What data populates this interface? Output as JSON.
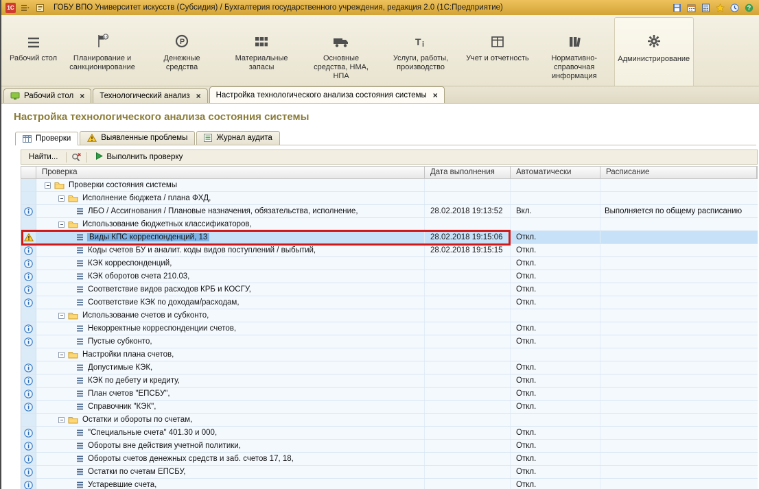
{
  "colors": {
    "annotation_red": "#d01818",
    "selection_blue": "#c7e2f8",
    "title_gold": "#8a7c39",
    "titlebar_gold": "#d2a336"
  },
  "titlebar": {
    "title": "ГОБУ ВПО Университет искусств (Субсидия) / Бухгалтерия государственного учреждения, редакция 2.0 (1С:Предприятие)",
    "right_icons": [
      "save",
      "calendar",
      "calculator",
      "favorites",
      "history",
      "help"
    ]
  },
  "ribbon": {
    "sections": [
      {
        "id": "desktop",
        "label": "Рабочий стол",
        "icon": "menu",
        "active": false
      },
      {
        "id": "planning",
        "label": "Планирование и санкционирование",
        "icon": "plan",
        "active": false
      },
      {
        "id": "money",
        "label": "Денежные средства",
        "icon": "money",
        "active": false
      },
      {
        "id": "materials",
        "label": "Материальные запасы",
        "icon": "mat",
        "active": false
      },
      {
        "id": "assets",
        "label": "Основные средства, НМА, НПА",
        "icon": "truck",
        "active": false
      },
      {
        "id": "services",
        "label": "Услуги, работы, производство",
        "icon": "serv",
        "active": false
      },
      {
        "id": "accounting",
        "label": "Учет и отчетность",
        "icon": "acct",
        "active": false
      },
      {
        "id": "reference",
        "label": "Нормативно-справочная информация",
        "icon": "ref",
        "active": false
      },
      {
        "id": "administration",
        "label": "Администрирование",
        "icon": "gear",
        "active": true
      }
    ]
  },
  "tabs": [
    {
      "id": "desktop",
      "label": "Рабочий стол",
      "icon": "desk",
      "active": false
    },
    {
      "id": "tech-analysis",
      "label": "Технологический анализ",
      "icon": "",
      "active": false
    },
    {
      "id": "tech-settings",
      "label": "Настройка технологического анализа состояния системы",
      "icon": "",
      "active": true
    }
  ],
  "page": {
    "title": "Настройка технологического анализа состояния системы",
    "subtabs": [
      {
        "id": "checks",
        "label": "Проверки",
        "icon": "tbl",
        "active": true
      },
      {
        "id": "problems",
        "label": "Выявленные проблемы",
        "icon": "warn",
        "active": false
      },
      {
        "id": "audit",
        "label": "Журнал аудита",
        "icon": "jour",
        "active": false
      }
    ],
    "toolbar": {
      "find_label": "Найти...",
      "run_label": "Выполнить проверку"
    },
    "table": {
      "columns": [
        "Проверка",
        "Дата выполнения",
        "Автоматически",
        "Расписание"
      ],
      "rows": [
        {
          "type": "folder",
          "level": 0,
          "label": "Проверки состояния системы",
          "date": "",
          "auto": "",
          "schedule": ""
        },
        {
          "type": "folder",
          "level": 1,
          "label": "Исполнение бюджета / плана ФХД,",
          "date": "",
          "auto": "",
          "schedule": ""
        },
        {
          "type": "leaf",
          "level": 2,
          "label": "ЛБО / Ассигнования / Плановые назначения, обязательства, исполнение,",
          "date": "28.02.2018 19:13:52",
          "auto": "Вкл.",
          "schedule": "Выполняется по общему расписанию"
        },
        {
          "type": "folder",
          "level": 1,
          "label": "Использование бюджетных классификаторов,",
          "date": "",
          "auto": "",
          "schedule": ""
        },
        {
          "type": "leaf",
          "level": 2,
          "label": "Виды КПС корреспонденций, 13",
          "date": "28.02.2018 19:15:06",
          "auto": "Откл.",
          "schedule": "",
          "selected": true,
          "warning": true
        },
        {
          "type": "leaf",
          "level": 2,
          "label": "Коды счетов БУ и аналит. коды видов поступлений / выбытий,",
          "date": "28.02.2018 19:15:15",
          "auto": "Откл.",
          "schedule": ""
        },
        {
          "type": "leaf",
          "level": 2,
          "label": "КЭК корреспонденций,",
          "date": "",
          "auto": "Откл.",
          "schedule": ""
        },
        {
          "type": "leaf",
          "level": 2,
          "label": "КЭК оборотов счета 210.03,",
          "date": "",
          "auto": "Откл.",
          "schedule": ""
        },
        {
          "type": "leaf",
          "level": 2,
          "label": "Соответствие видов расходов КРБ и КОСГУ,",
          "date": "",
          "auto": "Откл.",
          "schedule": ""
        },
        {
          "type": "leaf",
          "level": 2,
          "label": "Соответствие КЭК по доходам/расходам,",
          "date": "",
          "auto": "Откл.",
          "schedule": ""
        },
        {
          "type": "folder",
          "level": 1,
          "label": "Использование счетов и субконто,",
          "date": "",
          "auto": "",
          "schedule": ""
        },
        {
          "type": "leaf",
          "level": 2,
          "label": "Некорректные корреспонденции счетов,",
          "date": "",
          "auto": "Откл.",
          "schedule": ""
        },
        {
          "type": "leaf",
          "level": 2,
          "label": "Пустые субконто,",
          "date": "",
          "auto": "Откл.",
          "schedule": ""
        },
        {
          "type": "folder",
          "level": 1,
          "label": "Настройки плана счетов,",
          "date": "",
          "auto": "",
          "schedule": ""
        },
        {
          "type": "leaf",
          "level": 2,
          "label": "Допустимые КЭК,",
          "date": "",
          "auto": "Откл.",
          "schedule": ""
        },
        {
          "type": "leaf",
          "level": 2,
          "label": "КЭК по дебету и кредиту,",
          "date": "",
          "auto": "Откл.",
          "schedule": ""
        },
        {
          "type": "leaf",
          "level": 2,
          "label": "План счетов \"ЕПСБУ\",",
          "date": "",
          "auto": "Откл.",
          "schedule": ""
        },
        {
          "type": "leaf",
          "level": 2,
          "label": "Справочник \"КЭК\",",
          "date": "",
          "auto": "Откл.",
          "schedule": ""
        },
        {
          "type": "folder",
          "level": 1,
          "label": "Остатки и обороты по счетам,",
          "date": "",
          "auto": "",
          "schedule": ""
        },
        {
          "type": "leaf",
          "level": 2,
          "label": "\"Специальные счета\" 401.30 и 000,",
          "date": "",
          "auto": "Откл.",
          "schedule": ""
        },
        {
          "type": "leaf",
          "level": 2,
          "label": "Обороты вне действия учетной политики,",
          "date": "",
          "auto": "Откл.",
          "schedule": ""
        },
        {
          "type": "leaf",
          "level": 2,
          "label": "Обороты счетов денежных средств и заб. счетов 17, 18,",
          "date": "",
          "auto": "Откл.",
          "schedule": ""
        },
        {
          "type": "leaf",
          "level": 2,
          "label": "Остатки по счетам ЕПСБУ,",
          "date": "",
          "auto": "Откл.",
          "schedule": ""
        },
        {
          "type": "leaf",
          "level": 2,
          "label": "Устаревшие счета,",
          "date": "",
          "auto": "Откл.",
          "schedule": ""
        }
      ]
    }
  }
}
